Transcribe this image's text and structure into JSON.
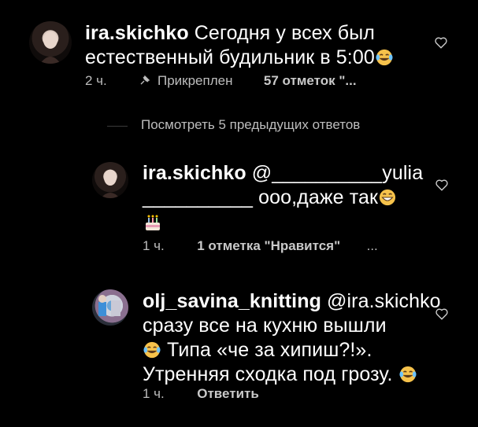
{
  "comments": [
    {
      "username": "ira.skichko",
      "text_line1": "Сегодня у всех был",
      "text_line2": "естественный будильник в 5:00",
      "time": "2 ч.",
      "pinned": "Прикреплен",
      "likes": "57 отметок \"...",
      "emoji": "joy-emoji"
    },
    {
      "username": "ira.skichko",
      "mention": "@__________yulia",
      "line2_pre": "__________",
      "line2_text": "ооо,даже так",
      "time": "1 ч.",
      "likes": "1 отметка \"Нравится\"",
      "more": "..."
    },
    {
      "username": "olj_savina_knitting",
      "mention": "@ira.skichko",
      "line2": "сразу все на кухню вышли",
      "line3": "Типа «че за хипиш?!».",
      "line4": "Утренняя сходка под грозу.",
      "time": "1 ч.",
      "reply": "Ответить"
    }
  ],
  "view_previous": "Посмотреть 5 предыдущих ответов",
  "colors": {
    "background": "#000000",
    "text": "#ffffff",
    "meta": "#bdbdbd"
  }
}
